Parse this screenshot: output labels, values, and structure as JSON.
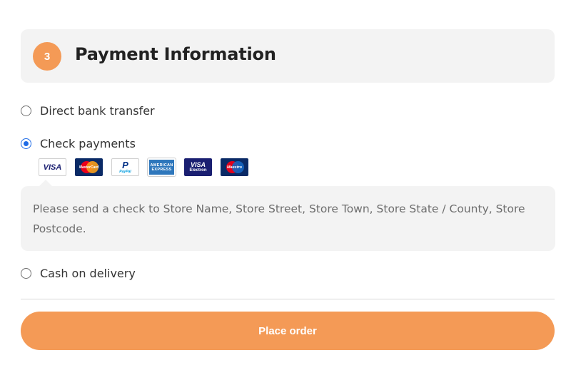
{
  "section": {
    "step_number": "3",
    "title": "Payment Information"
  },
  "payment_methods": [
    {
      "label": "Direct bank transfer",
      "selected": false
    },
    {
      "label": "Check payments",
      "selected": true
    },
    {
      "label": "Cash on delivery",
      "selected": false
    }
  ],
  "card_logos": {
    "visa": "VISA",
    "mastercard": "MasterCard",
    "paypal_mark": "P",
    "paypal": "PayPal",
    "amex_line1": "AMERICAN",
    "amex_line2": "EXPRESS",
    "visa_electron_mark": "VISA",
    "visa_electron": "Electron",
    "maestro": "Maestro"
  },
  "check_description": "Please send a check to Store Name, Store Street, Store Town, Store State / County, Store Postcode.",
  "place_order_label": "Place order",
  "colors": {
    "accent": "#f49a56",
    "radio_selected": "#1e6be6",
    "panel_bg": "#f3f3f3"
  }
}
